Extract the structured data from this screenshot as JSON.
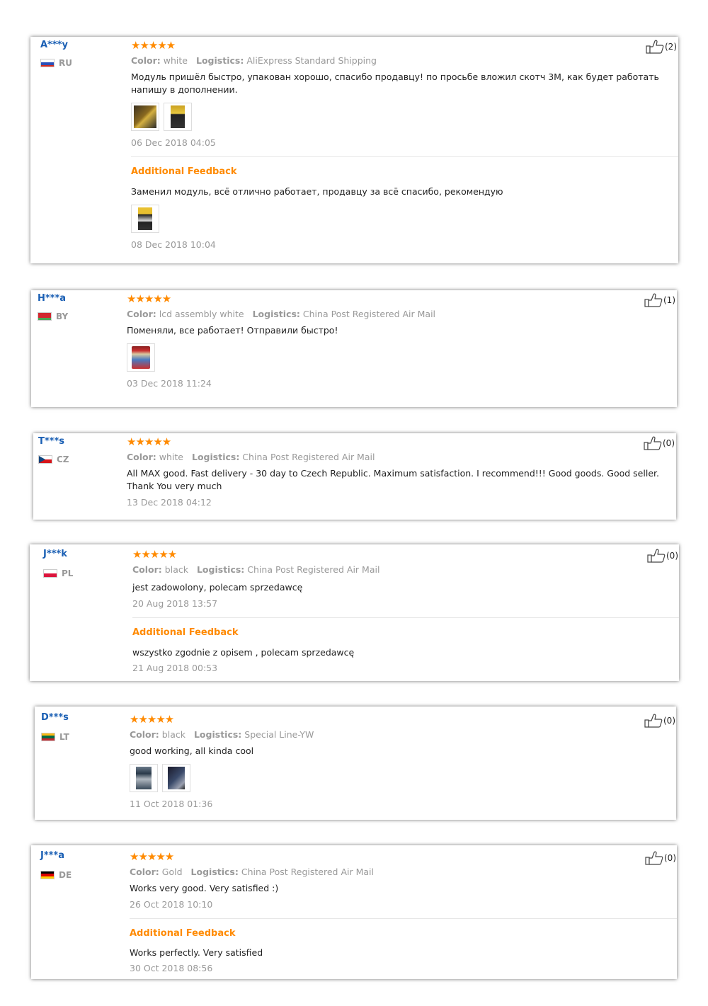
{
  "colors": {
    "username": "#1a5fb4",
    "stars": "#ff8a00",
    "additional_feedback": "#ff8a00",
    "muted": "#999999",
    "text": "#222222"
  },
  "icons": {
    "stars": "star-icon",
    "like": "thumbs-up-icon",
    "flag": "flag-icon",
    "photo": "photo-thumbnail"
  },
  "labels": {
    "color": "Color:",
    "logistics": "Logistics:",
    "additional_feedback": "Additional Feedback",
    "stars": "★★★★★"
  },
  "reviews": [
    {
      "user": "A***y",
      "country": "RU",
      "rating": 5,
      "color": "white",
      "logistics": "AliExpress Standard Shipping",
      "text": "Модуль пришёл быстро, упакован хорошо, спасибо продавцу! по просьбе вложил скотч 3M, как будет работать напишу в дополнении.",
      "date": "06 Dec 2018 04:05",
      "likes": "(2)",
      "additional": {
        "text": "Заменил модуль, всё отлично работает, продавцу за всё спасибо, рекомендую",
        "date": "08 Dec 2018 10:04"
      }
    },
    {
      "user": "H***a",
      "country": "BY",
      "rating": 5,
      "color": "lcd assembly white",
      "logistics": "China Post Registered Air Mail",
      "text": "Поменяли, все работает! Отправили быстро!",
      "date": "03 Dec 2018 11:24",
      "likes": "(1)"
    },
    {
      "user": "T***s",
      "country": "CZ",
      "rating": 5,
      "color": "white",
      "logistics": "China Post Registered Air Mail",
      "text": "All MAX good. Fast delivery - 30 day to Czech Republic. Maximum satisfaction. I recommend!!! Good goods. Good seller. Thank You very much",
      "date": "13 Dec 2018 04:12",
      "likes": "(0)"
    },
    {
      "user": "J***k",
      "country": "PL",
      "rating": 5,
      "color": "black",
      "logistics": "China Post Registered Air Mail",
      "text": "jest zadowolony, polecam sprzedawcę",
      "date": "20 Aug 2018 13:57",
      "likes": "(0)",
      "additional": {
        "text": "wszystko zgodnie z opisem , polecam sprzedawcę",
        "date": "21 Aug 2018 00:53"
      }
    },
    {
      "user": "D***s",
      "country": "LT",
      "rating": 5,
      "color": "black",
      "logistics": "Special Line-YW",
      "text": "good working, all kinda cool",
      "date": "11 Oct 2018 01:36",
      "likes": "(0)"
    },
    {
      "user": "J***a",
      "country": "DE",
      "rating": 5,
      "color": "Gold",
      "logistics": "China Post Registered Air Mail",
      "text": "Works very good. Very satisfied :)",
      "date": "26 Oct 2018 10:10",
      "likes": "(0)",
      "additional": {
        "text": "Works perfectly. Very satisfied",
        "date": "30 Oct 2018 08:56"
      }
    }
  ]
}
